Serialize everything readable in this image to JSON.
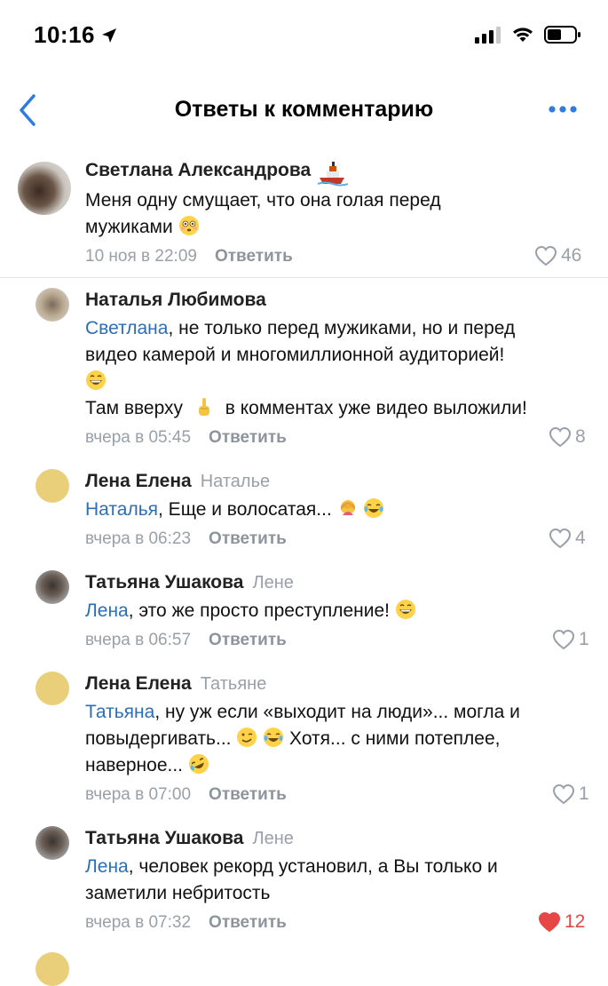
{
  "status": {
    "time": "10:16"
  },
  "header": {
    "title": "Ответы к комментарию"
  },
  "comments": [
    {
      "author": "Светлана Александрова",
      "reply_to": "",
      "text_lines": [
        "Меня одну смущает, что она голая перед",
        "мужиками"
      ],
      "date": "10 ноя в 22:09",
      "reply_label": "Ответить",
      "likes": "46",
      "liked": false
    },
    {
      "author": "Наталья Любимова",
      "reply_to": "",
      "mention": "Светлана",
      "text_parts": [
        ", не только перед мужиками, но и перед",
        "видео камерой и многомиллионной аудиторией!",
        "Там вверху",
        "в комментах уже видео выложили!"
      ],
      "date": "вчера в 05:45",
      "reply_label": "Ответить",
      "likes": "8",
      "liked": false
    },
    {
      "author": "Лена Елена",
      "reply_to": "Наталье",
      "mention": "Наталья",
      "text_parts": [
        ", Еще и волосатая..."
      ],
      "date": "вчера в 06:23",
      "reply_label": "Ответить",
      "likes": "4",
      "liked": false
    },
    {
      "author": "Татьяна Ушакова",
      "reply_to": "Лене",
      "mention": "Лена",
      "text_parts": [
        ", это же просто преступление!"
      ],
      "date": "вчера в 06:57",
      "reply_label": "Ответить",
      "likes": "1",
      "liked": false
    },
    {
      "author": "Лена Елена",
      "reply_to": "Татьяне",
      "mention": "Татьяна",
      "text_parts": [
        ", ну уж если «выходит на люди»... могла и",
        "повыдергивать...",
        "Хотя... с ними потеплее,",
        "наверное..."
      ],
      "date": "вчера в 07:00",
      "reply_label": "Ответить",
      "likes": "1",
      "liked": false
    },
    {
      "author": "Татьяна Ушакова",
      "reply_to": "Лене",
      "mention": "Лена",
      "text_parts": [
        ", человек рекорд установил,  а Вы только и",
        "заметили  небритость"
      ],
      "date": "вчера в 07:32",
      "reply_label": "Ответить",
      "likes": "12",
      "liked": true
    }
  ],
  "colors": {
    "accent": "#2a6fb8",
    "nav_icon": "#2f7be0",
    "like_active": "#e64646",
    "muted": "#9aa0a8"
  },
  "icons": [
    "back-chevron-icon",
    "more-dots-icon",
    "heart-icon",
    "location-arrow-icon",
    "signal-icon",
    "wifi-icon",
    "battery-icon"
  ]
}
